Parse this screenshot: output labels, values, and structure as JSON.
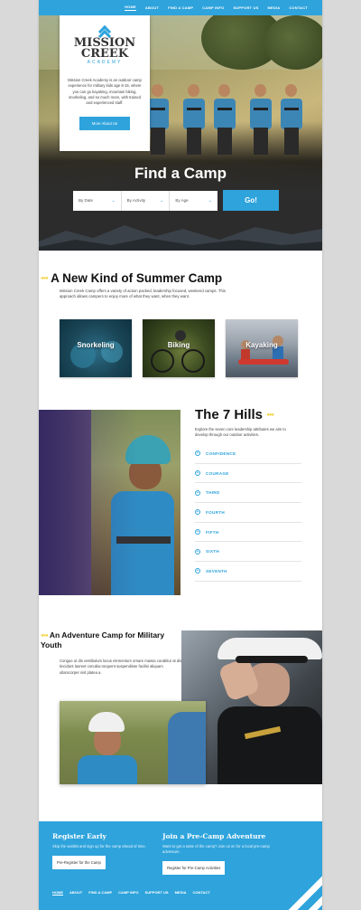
{
  "nav": {
    "items": [
      "HOME",
      "ABOUT",
      "FIND A CAMP",
      "CAMP INFO",
      "SUPPORT US",
      "MEDIA",
      "CONTACT"
    ]
  },
  "logo": {
    "title_line1": "MISSION",
    "title_line2": "CREEK",
    "subtitle": "ACADEMY"
  },
  "intro": {
    "text": "Mission Creek Academy is an outdoor camp experience for military kids age 8-15, where you can go kayaking, mountain biking, snorkeling, and so much more, with trained and experienced staff.",
    "button": "More About Us"
  },
  "search": {
    "title": "Find a Camp",
    "filters": [
      "By Date",
      "By Activity",
      "By Age"
    ],
    "go_label": "Go!"
  },
  "summer": {
    "title": "A New Kind of Summer Camp",
    "text": "Mission Creek Camp offers a variety of action packed, leadership focused, weekend camps. This approach allows campers to enjoy more of what they want, when they want.",
    "activities": [
      "Snorkeling",
      "Biking",
      "Kayaking"
    ]
  },
  "hills": {
    "title": "The 7 Hills",
    "text": "Explore the seven core leadership attributes we aim to develop through our outdoor activities.",
    "items": [
      "CONFIDENCE",
      "COURAGE",
      "THIRD",
      "FOURTH",
      "FIFTH",
      "SIXTH",
      "SEVENTH"
    ]
  },
  "adventure": {
    "title": "An Adventure Camp for Military Youth",
    "text": "Congue ut dis vestibulum lacus elementum ornare massa curabitur at dis tincidunt laoreet conubia torquent suspendisse facilisi aliquam ullamcorper nisl platea a."
  },
  "footer": {
    "register_title": "Register Early",
    "register_text": "Skip the waitlist and sign up for the camp ahead of time.",
    "register_button": "Pre-Register for the Camp",
    "precamp_title": "Join a Pre-Camp Adventure",
    "precamp_text": "Want to get a taste of the camp? Join us on for a local pre-camp adventure.",
    "precamp_button": "Register for Pre-Camp Activities",
    "nav": [
      "HOME",
      "ABOUT",
      "FIND A CAMP",
      "CAMP INFO",
      "SUPPORT US",
      "MEDIA",
      "CONTACT"
    ]
  },
  "colors": {
    "accent": "#2ea3dc",
    "dots": "#f2d64b",
    "dark": "#2b2b2b"
  }
}
